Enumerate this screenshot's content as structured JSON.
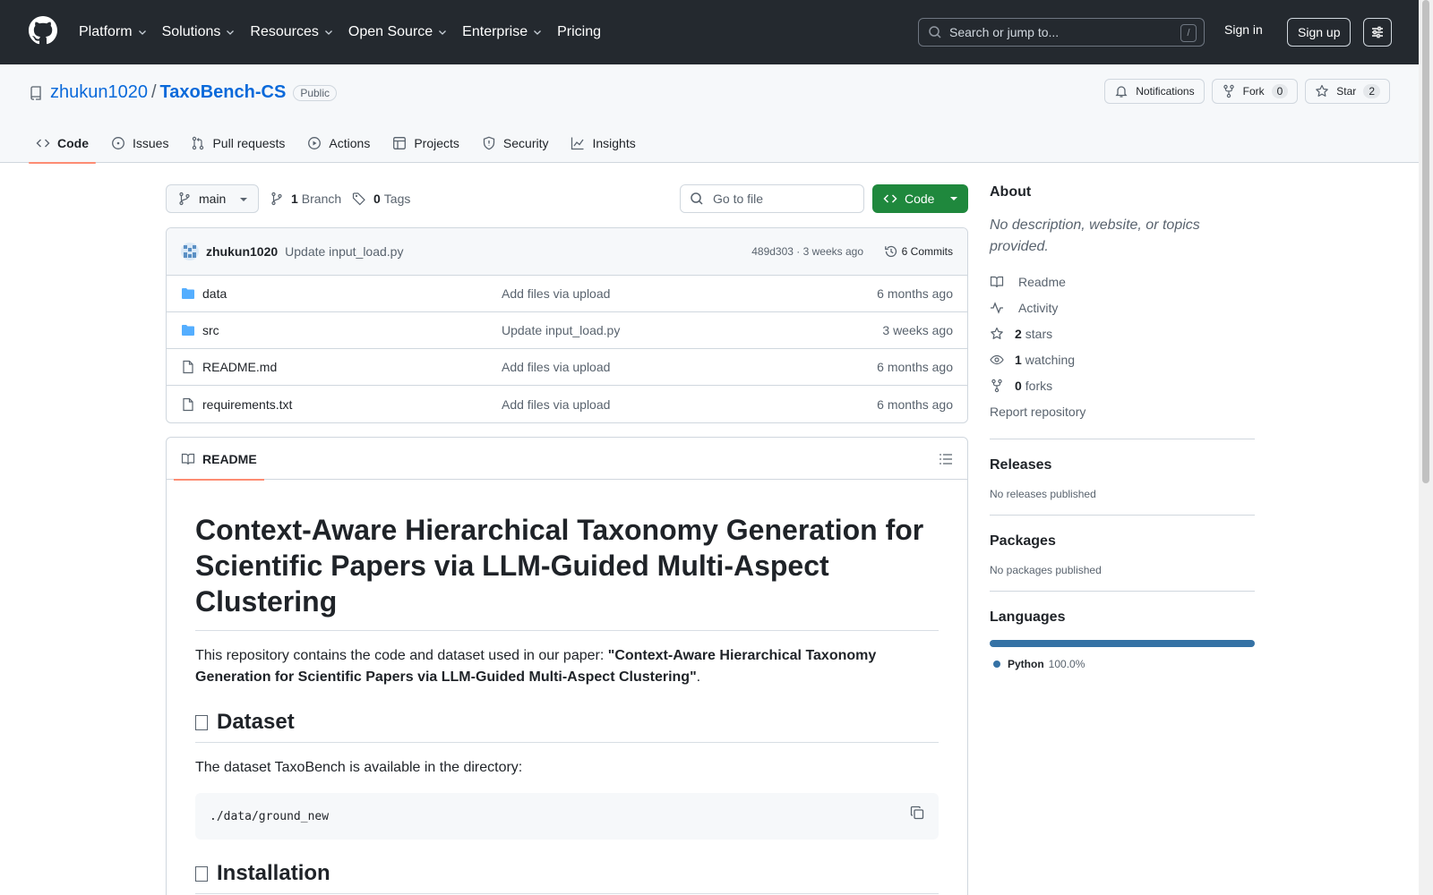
{
  "header": {
    "nav": [
      {
        "label": "Platform",
        "dropdown": true
      },
      {
        "label": "Solutions",
        "dropdown": true
      },
      {
        "label": "Resources",
        "dropdown": true
      },
      {
        "label": "Open Source",
        "dropdown": true
      },
      {
        "label": "Enterprise",
        "dropdown": true
      },
      {
        "label": "Pricing",
        "dropdown": false
      }
    ],
    "search_placeholder": "Search or jump to...",
    "search_key": "/",
    "sign_in": "Sign in",
    "sign_up": "Sign up"
  },
  "repo": {
    "owner": "zhukun1020",
    "separator": "/",
    "name": "TaxoBench-CS",
    "visibility": "Public",
    "notifications_label": "Notifications",
    "fork_label": "Fork",
    "fork_count": "0",
    "star_label": "Star",
    "star_count": "2",
    "tabs": [
      {
        "label": "Code",
        "icon": "code-icon",
        "active": true
      },
      {
        "label": "Issues",
        "icon": "issue-icon",
        "active": false
      },
      {
        "label": "Pull requests",
        "icon": "pull-request-icon",
        "active": false
      },
      {
        "label": "Actions",
        "icon": "play-icon",
        "active": false
      },
      {
        "label": "Projects",
        "icon": "table-icon",
        "active": false
      },
      {
        "label": "Security",
        "icon": "shield-icon",
        "active": false
      },
      {
        "label": "Insights",
        "icon": "graph-icon",
        "active": false
      }
    ]
  },
  "filenav": {
    "branch": "main",
    "branch_count": "1",
    "branch_label": "Branch",
    "tag_count": "0",
    "tag_label": "Tags",
    "goto_placeholder": "Go to file",
    "code_label": "Code"
  },
  "commit": {
    "author": "zhukun1020",
    "message": "Update input_load.py",
    "meta": "489d303 · 3 weeks ago",
    "count_label": "6 Commits"
  },
  "files": [
    {
      "name": "data",
      "type": "folder",
      "commit": "Add files via upload",
      "date": "6 months ago"
    },
    {
      "name": "src",
      "type": "folder",
      "commit": "Update input_load.py",
      "date": "3 weeks ago"
    },
    {
      "name": "README.md",
      "type": "file",
      "commit": "Add files via upload",
      "date": "6 months ago"
    },
    {
      "name": "requirements.txt",
      "type": "file",
      "commit": "Add files via upload",
      "date": "6 months ago"
    }
  ],
  "readme": {
    "tab_label": "README",
    "title": "Context-Aware Hierarchical Taxonomy Generation for Scientific Papers via LLM-Guided Multi-Aspect Clustering",
    "intro_prefix": "This repository contains the code and dataset used in our paper: ",
    "intro_bold": "\"Context-Aware Hierarchical Taxonomy Generation for Scientific Papers via LLM-Guided Multi-Aspect Clustering\"",
    "intro_suffix": ".",
    "h2_dataset": "Dataset",
    "dataset_text": "The dataset TaxoBench is available in the directory:",
    "dataset_path": "./data/ground_new",
    "h2_install": "Installation"
  },
  "sidebar": {
    "about_title": "About",
    "about_desc": "No description, website, or topics provided.",
    "items": [
      {
        "icon": "book-icon",
        "bold": "",
        "label": "Readme"
      },
      {
        "icon": "pulse-icon",
        "bold": "",
        "label": "Activity"
      },
      {
        "icon": "star-icon",
        "bold": "2",
        "label": "stars"
      },
      {
        "icon": "eye-icon",
        "bold": "1",
        "label": "watching"
      },
      {
        "icon": "fork-icon",
        "bold": "0",
        "label": "forks"
      }
    ],
    "report": "Report repository",
    "releases_title": "Releases",
    "releases_text": "No releases published",
    "packages_title": "Packages",
    "packages_text": "No packages published",
    "languages_title": "Languages",
    "language_name": "Python",
    "language_pct": "100.0%",
    "language_color": "#3572A5"
  }
}
